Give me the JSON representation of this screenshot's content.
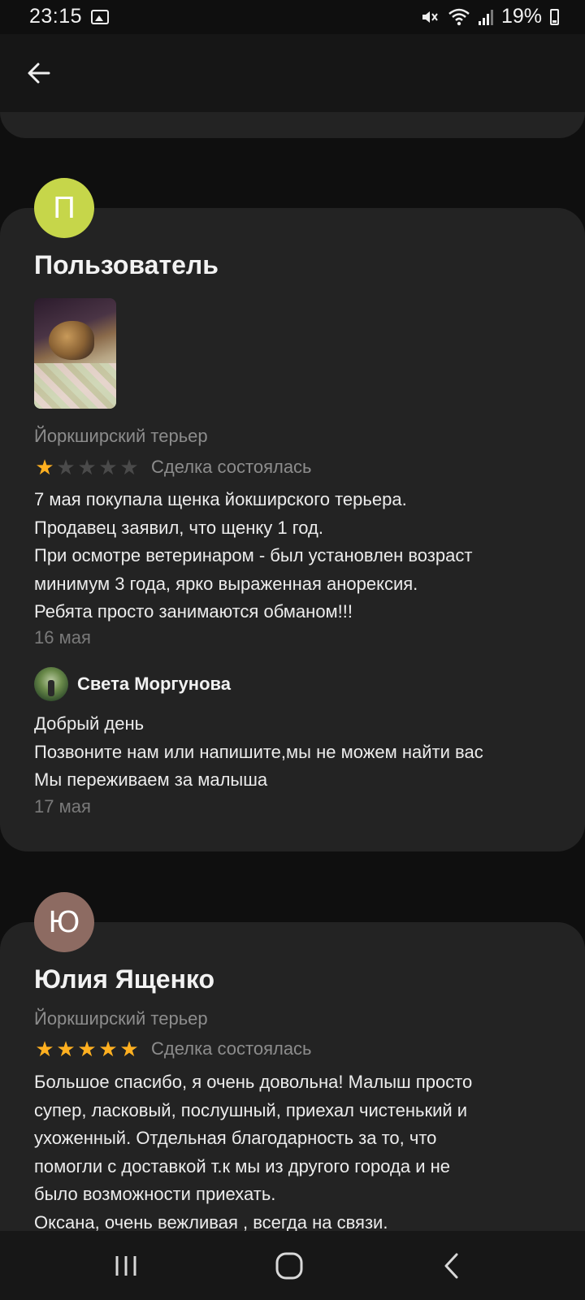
{
  "status_bar": {
    "time": "23:15",
    "battery": "19%",
    "icons": [
      "gallery-icon",
      "mute-icon",
      "wifi-icon",
      "signal-icon",
      "battery-icon"
    ]
  },
  "app_bar": {
    "back_icon": "arrow-left-icon"
  },
  "reviews": [
    {
      "avatar_letter": "П",
      "avatar_color": "#c6d64a",
      "author": "Пользователь",
      "breed": "Йоркширский терьер",
      "rating": 1,
      "max_rating": 5,
      "deal_status": "Сделка состоялась",
      "text_lines": [
        "7 мая покупала щенка йокширского терьера.",
        "Продавец заявил, что щенку 1 год.",
        "При осмотре ветеринаром - был установлен возраст",
        "минимум 3 года, ярко выраженная анорексия.",
        "Ребята просто занимаются обманом!!!"
      ],
      "date": "16 мая",
      "reply": {
        "author": "Света Моргунова",
        "text_lines": [
          "Добрый день",
          "Позвоните нам или напишите,мы не можем найти вас",
          "Мы переживаем за малыша"
        ],
        "date": "17 мая"
      }
    },
    {
      "avatar_letter": "Ю",
      "avatar_color": "#8d6b62",
      "author": "Юлия Ященко",
      "breed": "Йоркширский терьер",
      "rating": 5,
      "max_rating": 5,
      "deal_status": "Сделка состоялась",
      "text_lines": [
        "Большое спасибо, я очень довольна! Малыш просто",
        "супер, ласковый, послушный, приехал чистенький и",
        "ухоженный. Отдельная благодарность за то, что",
        "помогли с доставкой т.к мы из другого города и не",
        "было возможности приехать.",
        "Оксана, очень вежливая , всегда на связи."
      ]
    }
  ],
  "nav_bar": {
    "icons": [
      "recent-apps-icon",
      "home-icon",
      "back-icon"
    ]
  },
  "colors": {
    "star_on": "#ffb020",
    "star_off": "#4a4a4a",
    "card_bg": "#232323",
    "page_bg": "#0f0f0f"
  }
}
